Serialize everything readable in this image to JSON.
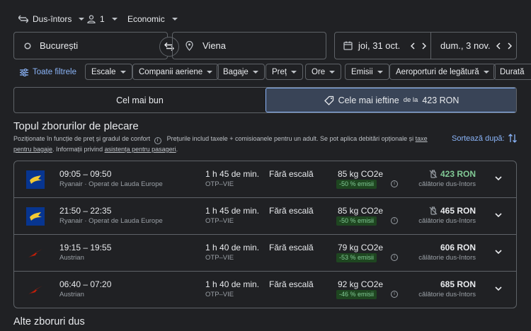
{
  "search": {
    "trip_type": "Dus-întors",
    "passengers": "1",
    "cabin_class": "Economic",
    "origin": "București",
    "destination": "Viena",
    "depart_date": "joi, 31 oct.",
    "return_date": "dum., 3 nov."
  },
  "filters": {
    "all_filters": "Toate filtrele",
    "chips": [
      "Escale",
      "Companii aeriene",
      "Bagaje",
      "Preț",
      "Ore",
      "Emisii",
      "Aeroporturi de legătură",
      "Durată"
    ]
  },
  "tabs": {
    "best": "Cel mai bun",
    "cheapest": "Cele mai ieftine",
    "cheapest_from": "de la",
    "cheapest_price": "423 RON"
  },
  "section": {
    "title": "Topul zborurilor de plecare",
    "ranking_note": "Poziționate în funcție de preț și gradul de confort",
    "price_note": "Prețurile includ taxele + comisioanele pentru un adult. Se pot aplica debitări opționale și",
    "price_note_link": "taxe pentru bagaje",
    "info_text": ". Informații privind",
    "assist_link": "asistența pentru pasageri",
    "sort_label": "Sortează după:",
    "other_title": "Alte zboruri dus"
  },
  "flights": [
    {
      "times": "09:05 – 09:50",
      "airline": "Ryanair · Operat de Lauda Europe",
      "logo": "ryanair",
      "duration": "1 h 45 de min.",
      "route": "OTP–VIE",
      "stops": "Fără escală",
      "co2": "85 kg CO2e",
      "emissions": "-50 % emisii",
      "price": "423 RON",
      "price_note": "călătorie dus-întors",
      "cheapest": true,
      "no_bag": true
    },
    {
      "times": "21:50 – 22:35",
      "airline": "Ryanair · Operat de Lauda Europe",
      "logo": "ryanair",
      "duration": "1 h 45 de min.",
      "route": "OTP–VIE",
      "stops": "Fără escală",
      "co2": "85 kg CO2e",
      "emissions": "-50 % emisii",
      "price": "465 RON",
      "price_note": "călătorie dus-întors",
      "cheapest": false,
      "no_bag": true
    },
    {
      "times": "19:15 – 19:55",
      "airline": "Austrian",
      "logo": "austrian",
      "duration": "1 h 40 de min.",
      "route": "OTP–VIE",
      "stops": "Fără escală",
      "co2": "79 kg CO2e",
      "emissions": "-53 % emisii",
      "price": "606 RON",
      "price_note": "călătorie dus-întors",
      "cheapest": false,
      "no_bag": false
    },
    {
      "times": "06:40 – 07:20",
      "airline": "Austrian",
      "logo": "austrian",
      "duration": "1 h 40 de min.",
      "route": "OTP–VIE",
      "stops": "Fără escală",
      "co2": "92 kg CO2e",
      "emissions": "-46 % emisii",
      "price": "685 RON",
      "price_note": "călătorie dus-întors",
      "cheapest": false,
      "no_bag": false
    }
  ],
  "colors": {
    "accent": "#8ab4f8",
    "green": "#81c995",
    "active_tab": "#394457"
  }
}
